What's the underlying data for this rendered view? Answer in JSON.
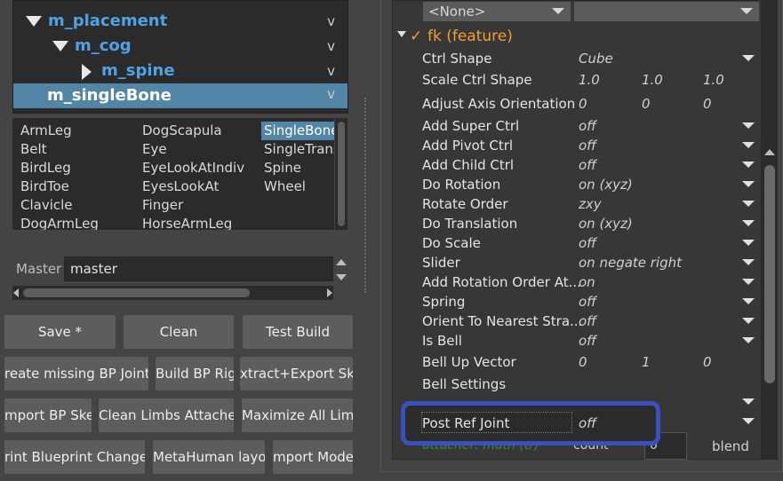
{
  "tree": {
    "items": [
      {
        "label": "m_placement",
        "v": "v"
      },
      {
        "label": "m_cog",
        "v": "v"
      },
      {
        "label": "m_spine",
        "v": "v"
      },
      {
        "label": "m_singleBone",
        "v": "v"
      }
    ]
  },
  "modules": {
    "col1": [
      "ArmLeg",
      "Belt",
      "BirdLeg",
      "BirdToe",
      "Clavicle",
      "DogArmLeg"
    ],
    "col2": [
      "DogScapula",
      "Eye",
      "EyeLookAtIndiv",
      "EyesLookAt",
      "Finger",
      "HorseArmLeg"
    ],
    "col3": [
      "SingleBone",
      "SingleTrans",
      "Spine",
      "Wheel"
    ],
    "selected": "SingleBone"
  },
  "master": {
    "label": "Master",
    "value": "master"
  },
  "buttons": {
    "row1": [
      "Save *",
      "Clean",
      "Test Build"
    ],
    "row2": [
      "reate missing BP Joint",
      "Build BP Rig",
      "xtract+Export Ske"
    ],
    "row3": [
      "mport BP Ske",
      "Clean Limbs Attachers",
      "Maximize All Liml"
    ],
    "row4": [
      "rint Blueprint Change",
      "MetaHuman layou",
      "mport Mode"
    ]
  },
  "attrs": {
    "none_combo": "<None>",
    "section_check": "✓",
    "section_title": "fk (feature)",
    "rows": [
      {
        "label": "Ctrl Shape",
        "v1": "Cube",
        "v2": "",
        "v3": ""
      },
      {
        "label": "Scale Ctrl Shape",
        "v1": "1.0",
        "v2": "1.0",
        "v3": "1.0"
      },
      {
        "label": "Adjust Axis Orientation",
        "v1": "0",
        "v2": "0",
        "v3": "0"
      },
      {
        "label": "Add Super Ctrl",
        "v1": "off",
        "v2": "",
        "v3": ""
      },
      {
        "label": "Add Pivot Ctrl",
        "v1": "off",
        "v2": "",
        "v3": ""
      },
      {
        "label": "Add Child Ctrl",
        "v1": "off",
        "v2": "",
        "v3": ""
      },
      {
        "label": "Do Rotation",
        "v1": "on (xyz)",
        "v2": "",
        "v3": ""
      },
      {
        "label": "Rotate Order",
        "v1": "zxy",
        "v2": "",
        "v3": ""
      },
      {
        "label": "Do Translation",
        "v1": "on (xyz)",
        "v2": "",
        "v3": ""
      },
      {
        "label": "Do Scale",
        "v1": "off",
        "v2": "",
        "v3": ""
      },
      {
        "label": "Slider",
        "v1": "on negate right",
        "v2": "",
        "v3": ""
      },
      {
        "label": "Add Rotation Order At...",
        "v1": "on",
        "v2": "",
        "v3": ""
      },
      {
        "label": "Spring",
        "v1": "off",
        "v2": "",
        "v3": ""
      },
      {
        "label": "Orient To Nearest Stra...",
        "v1": "off",
        "v2": "",
        "v3": ""
      },
      {
        "label": "Is Bell",
        "v1": "off",
        "v2": "",
        "v3": ""
      },
      {
        "label": "Bell Up Vector",
        "v1": "0",
        "v2": "1",
        "v3": "0"
      },
      {
        "label": "Bell Settings",
        "v1": "",
        "v2": "",
        "v3": ""
      }
    ],
    "post_ref": {
      "label": "Post Ref Joint",
      "value": "off"
    },
    "bottom": {
      "attacher": "attacher: math (tr)",
      "count": "count",
      "zero": "0",
      "blend": "blend"
    }
  }
}
